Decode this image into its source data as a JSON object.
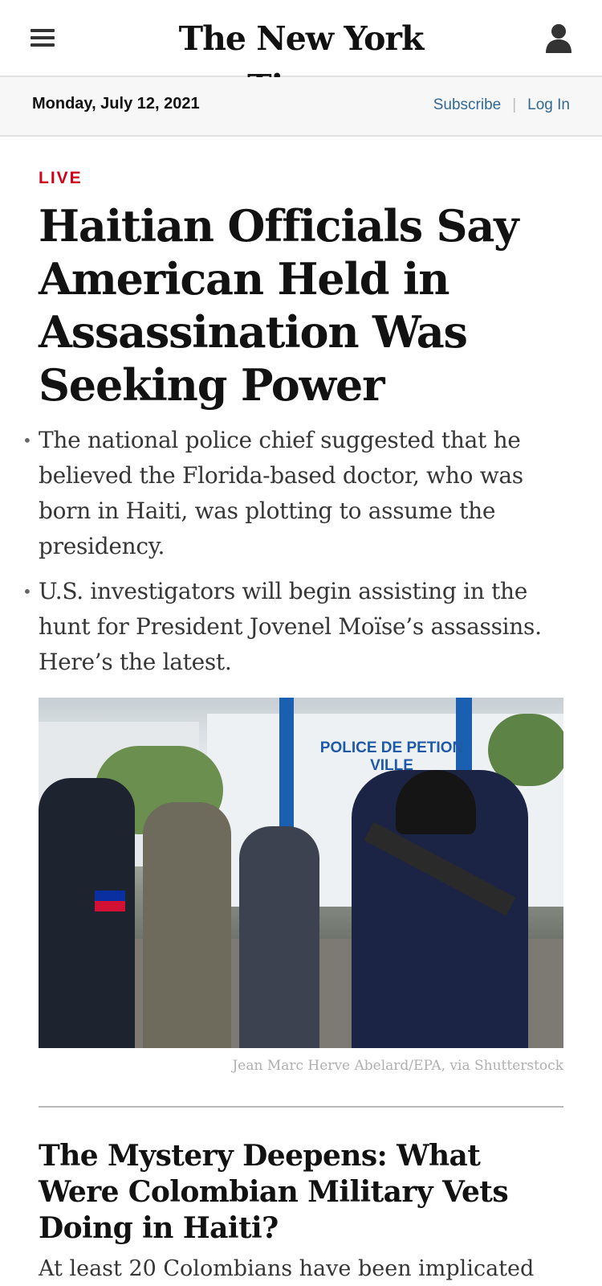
{
  "header": {
    "menu_icon": "hamburger-menu-icon",
    "masthead": "The New York Times",
    "account_icon": "user-account-icon"
  },
  "datebar": {
    "date": "Monday, July 12, 2021",
    "subscribe": "Subscribe",
    "login": "Log In"
  },
  "article": {
    "label": "LIVE",
    "label_color": "#d0021b",
    "headline": "Haitian Officials Say American Held in Assassination Was Seeking Power",
    "bullets": [
      "The national police chief suggested that he believed the Florida-based doctor, who was born in Haiti, was plotting to assume the presidency.",
      "U.S. investigators will begin assisting in the hunt for President Jovenel Moïse’s assassins. Here’s the latest."
    ],
    "photo_sign": "POLICE DE PETION VILLE",
    "photo_credit": "Jean Marc Herve Abelard/EPA, via Shutterstock"
  },
  "second_story": {
    "headline": "The Mystery Deepens: What Were Colombian Military Vets Doing in Haiti?",
    "summary": "At least 20 Colombians have been implicated"
  },
  "colors": {
    "link": "#326891",
    "live_red": "#d0021b"
  }
}
